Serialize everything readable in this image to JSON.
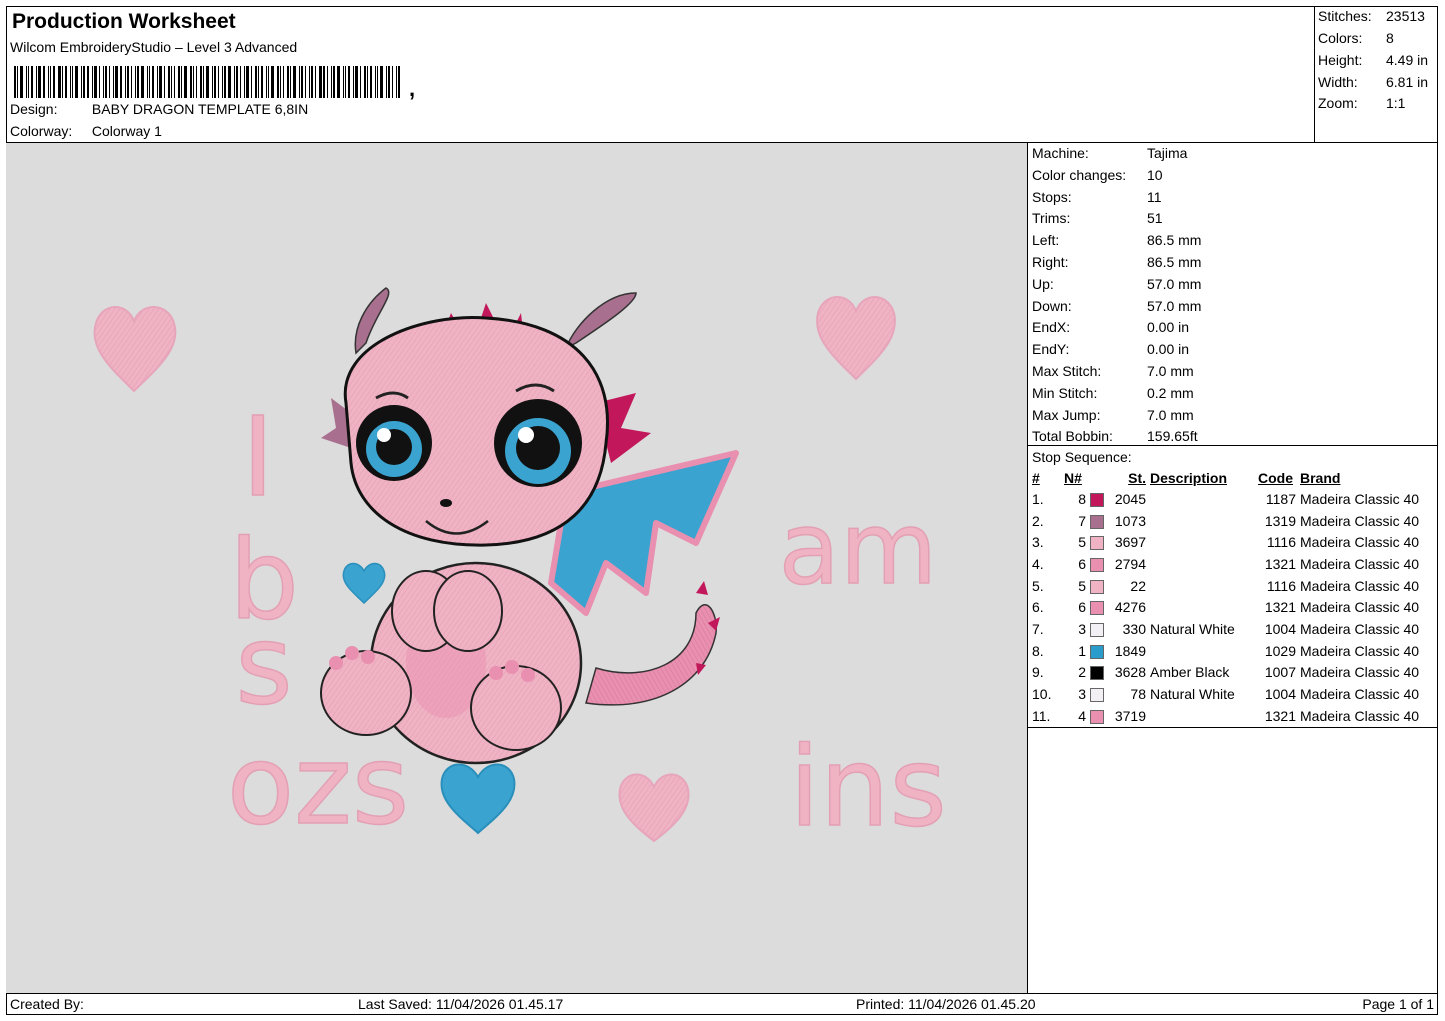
{
  "header": {
    "title": "Production Worksheet",
    "software": "Wilcom EmbroideryStudio – Level 3 Advanced",
    "design_label": "Design:",
    "design_value": "BABY DRAGON TEMPLATE 6,8IN",
    "colorway_label": "Colorway:",
    "colorway_value": "Colorway 1"
  },
  "stats": [
    {
      "label": "Stitches:",
      "value": "23513"
    },
    {
      "label": "Colors:",
      "value": "8"
    },
    {
      "label": "Height:",
      "value": "4.49 in"
    },
    {
      "label": "Width:",
      "value": "6.81 in"
    },
    {
      "label": "Zoom:",
      "value": "1:1"
    }
  ],
  "machine": [
    {
      "label": "Machine:",
      "value": "Tajima"
    },
    {
      "label": "Color changes:",
      "value": "10"
    },
    {
      "label": "Stops:",
      "value": "11"
    },
    {
      "label": "Trims:",
      "value": "51"
    },
    {
      "label": "Left:",
      "value": "86.5 mm"
    },
    {
      "label": "Right:",
      "value": "86.5 mm"
    },
    {
      "label": "Up:",
      "value": "57.0 mm"
    },
    {
      "label": "Down:",
      "value": "57.0 mm"
    },
    {
      "label": "EndX:",
      "value": "0.00 in"
    },
    {
      "label": "EndY:",
      "value": "0.00 in"
    },
    {
      "label": "Max Stitch:",
      "value": "7.0 mm"
    },
    {
      "label": "Min Stitch:",
      "value": "0.2 mm"
    },
    {
      "label": "Max Jump:",
      "value": "7.0 mm"
    },
    {
      "label": "Total Bobbin:",
      "value": "159.65ft"
    }
  ],
  "stop_sequence": {
    "title": "Stop Sequence:",
    "headers": [
      "#",
      "N#",
      "St.",
      "Description",
      "Code",
      "Brand"
    ],
    "rows": [
      {
        "idx": "1.",
        "n": "8",
        "color": "#c2185b",
        "st": "2045",
        "desc": "",
        "code": "1187",
        "brand": "Madeira Classic 40"
      },
      {
        "idx": "2.",
        "n": "7",
        "color": "#a8708e",
        "st": "1073",
        "desc": "",
        "code": "1319",
        "brand": "Madeira Classic 40"
      },
      {
        "idx": "3.",
        "n": "5",
        "color": "#f0b3c4",
        "st": "3697",
        "desc": "",
        "code": "1116",
        "brand": "Madeira Classic 40"
      },
      {
        "idx": "4.",
        "n": "6",
        "color": "#e98fb0",
        "st": "2794",
        "desc": "",
        "code": "1321",
        "brand": "Madeira Classic 40"
      },
      {
        "idx": "5.",
        "n": "5",
        "color": "#f0b3c4",
        "st": "22",
        "desc": "",
        "code": "1116",
        "brand": "Madeira Classic 40"
      },
      {
        "idx": "6.",
        "n": "6",
        "color": "#e98fb0",
        "st": "4276",
        "desc": "",
        "code": "1321",
        "brand": "Madeira Classic 40"
      },
      {
        "idx": "7.",
        "n": "3",
        "color": "#f2f0f4",
        "st": "330",
        "desc": "Natural White",
        "code": "1004",
        "brand": "Madeira Classic 40"
      },
      {
        "idx": "8.",
        "n": "1",
        "color": "#2a9ccc",
        "st": "1849",
        "desc": "",
        "code": "1029",
        "brand": "Madeira Classic 40"
      },
      {
        "idx": "9.",
        "n": "2",
        "color": "#000000",
        "st": "3628",
        "desc": "Amber Black",
        "code": "1007",
        "brand": "Madeira Classic 40"
      },
      {
        "idx": "10.",
        "n": "3",
        "color": "#f2f0f4",
        "st": "78",
        "desc": "Natural White",
        "code": "1004",
        "brand": "Madeira Classic 40"
      },
      {
        "idx": "11.",
        "n": "4",
        "color": "#e98fb0",
        "st": "3719",
        "desc": "",
        "code": "1321",
        "brand": "Madeira Classic 40"
      }
    ]
  },
  "design_text": {
    "i": "I",
    "b": "b",
    "s": "s",
    "ozs": "ozs",
    "am": "am",
    "ins": "ins"
  },
  "footer": {
    "created_by": "Created By:",
    "last_saved": "Last Saved: 11/04/2026 01.45.17",
    "printed": "Printed: 11/04/2026 01.45.20",
    "page": "Page 1 of 1"
  }
}
